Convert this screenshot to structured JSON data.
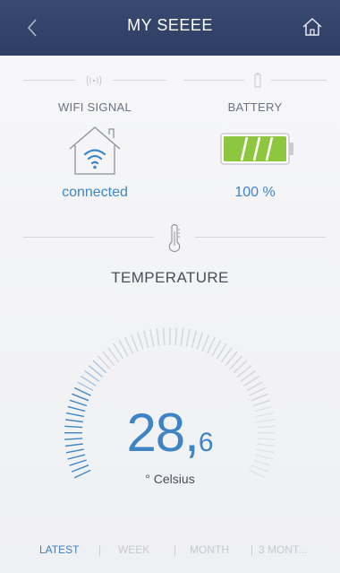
{
  "header": {
    "title": "MY SEEEE",
    "back_icon": "chevron-left-icon",
    "home_icon": "home-icon",
    "bar_color": "#33446b"
  },
  "wifi": {
    "label": "WIFI SIGNAL",
    "status": "connected",
    "icon": "wifi-house-icon"
  },
  "battery": {
    "label": "BATTERY",
    "value": "100 %",
    "level": 1.0,
    "icon": "battery-icon",
    "fill_color": "#8dc63f"
  },
  "temperature": {
    "title": "TEMPERATURE",
    "integer": "28,",
    "decimal": "6",
    "unit": "° Celsius",
    "accent_color": "#3f85c6"
  },
  "tabs": [
    {
      "label": "LATEST",
      "active": true
    },
    {
      "label": "WEEK",
      "active": false
    },
    {
      "label": "MONTH",
      "active": false
    },
    {
      "label": "3 MONT...",
      "active": false
    }
  ],
  "tab_separator": "|"
}
